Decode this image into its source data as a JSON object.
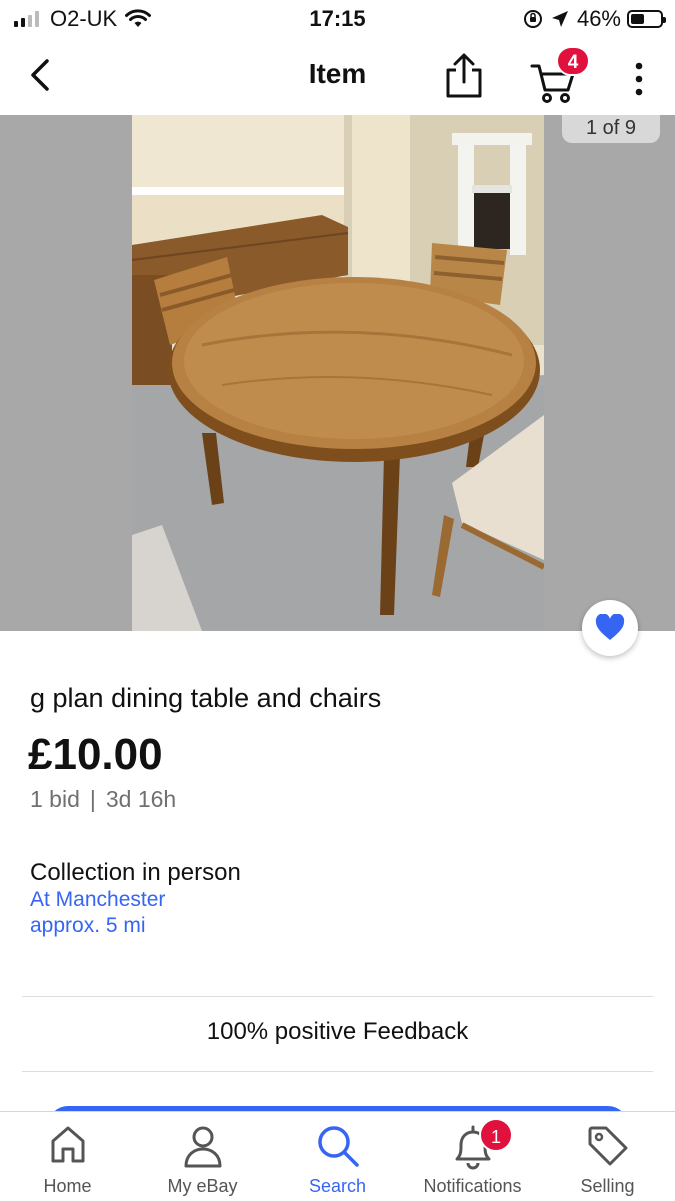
{
  "status_bar": {
    "carrier": "O2-UK",
    "time": "17:15",
    "battery": "46%",
    "battery_level": 0.46,
    "signal_bars": 2,
    "icons": [
      "wifi-icon",
      "orientation-lock-icon",
      "location-arrow-icon",
      "battery-icon"
    ]
  },
  "nav": {
    "title": "Item",
    "cart_count": "4",
    "icons": [
      "back-chevron-icon",
      "share-icon",
      "cart-icon",
      "more-vertical-icon"
    ]
  },
  "gallery": {
    "counter": "1 of 9",
    "watch_icon": "heart-icon"
  },
  "listing": {
    "title": "g plan dining table and chairs",
    "price": "£10.00",
    "bids": "1 bid",
    "separator": "|",
    "time_left": "3d 16h"
  },
  "delivery": {
    "method": "Collection in person",
    "location": "At Manchester",
    "distance": "approx. 5 mi"
  },
  "seller": {
    "feedback": "100% positive Feedback"
  },
  "tab_bar": {
    "tabs": [
      {
        "label": "Home",
        "icon": "home-icon"
      },
      {
        "label": "My eBay",
        "icon": "person-icon"
      },
      {
        "label": "Search",
        "icon": "search-icon",
        "active": true
      },
      {
        "label": "Notifications",
        "icon": "bell-icon",
        "badge": "1"
      },
      {
        "label": "Selling",
        "icon": "tag-icon"
      }
    ]
  },
  "colors": {
    "accent": "#3665f3",
    "badge": "#e0113d",
    "gallery_background": "#a8a8a8",
    "muted_text": "#707070"
  }
}
